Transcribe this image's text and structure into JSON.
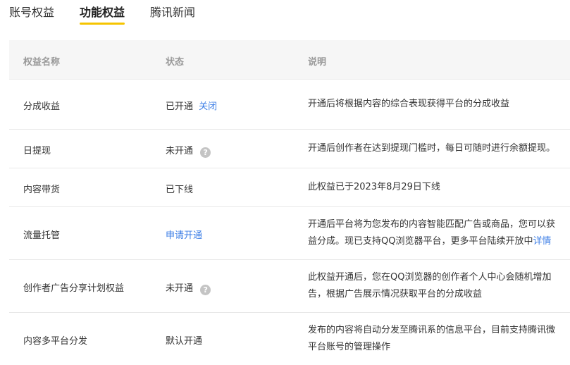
{
  "tabs": [
    {
      "label": "账号权益",
      "active": false
    },
    {
      "label": "功能权益",
      "active": true
    },
    {
      "label": "腾讯新闻",
      "active": false
    }
  ],
  "accent_color": "#f5c400",
  "link_color": "#3c7ee6",
  "table": {
    "headers": [
      "权益名称",
      "状态",
      "说明"
    ],
    "rows": [
      {
        "name": "分成收益",
        "status": "已开通",
        "action": "关闭",
        "desc1": "开通后将根据内容的综合表现获得平台的分成收益"
      },
      {
        "name": "日提现",
        "status": "未开通",
        "help_icon": "question-icon",
        "desc1": "开通后创作者在达到提现门槛时，每日可随时进行余额提现。"
      },
      {
        "name": "内容带货",
        "status": "已下线",
        "desc1": "此权益已于2023年8月29日下线"
      },
      {
        "name": "流量托管",
        "status": "申请开通",
        "desc1": "开通后平台将为您发布的内容智能匹配广告或商品，您可以获",
        "desc2": "益分成。现已支持QQ浏览器平台，更多平台陆续开放中",
        "desc2_link": "详情"
      },
      {
        "name": "创作者广告分享计划权益",
        "status": "未开通",
        "help_icon": "question-icon",
        "desc1": "此权益开通后，您在QQ浏览器的创作者个人中心会随机增加",
        "desc2": "告，根据广告展示情况获取平台的分成收益"
      },
      {
        "name": "内容多平台分发",
        "status": "默认开通",
        "desc1": "发布的内容将自动分发至腾讯系的信息平台，目前支持腾讯微",
        "desc2": "平台账号的管理操作"
      }
    ]
  }
}
